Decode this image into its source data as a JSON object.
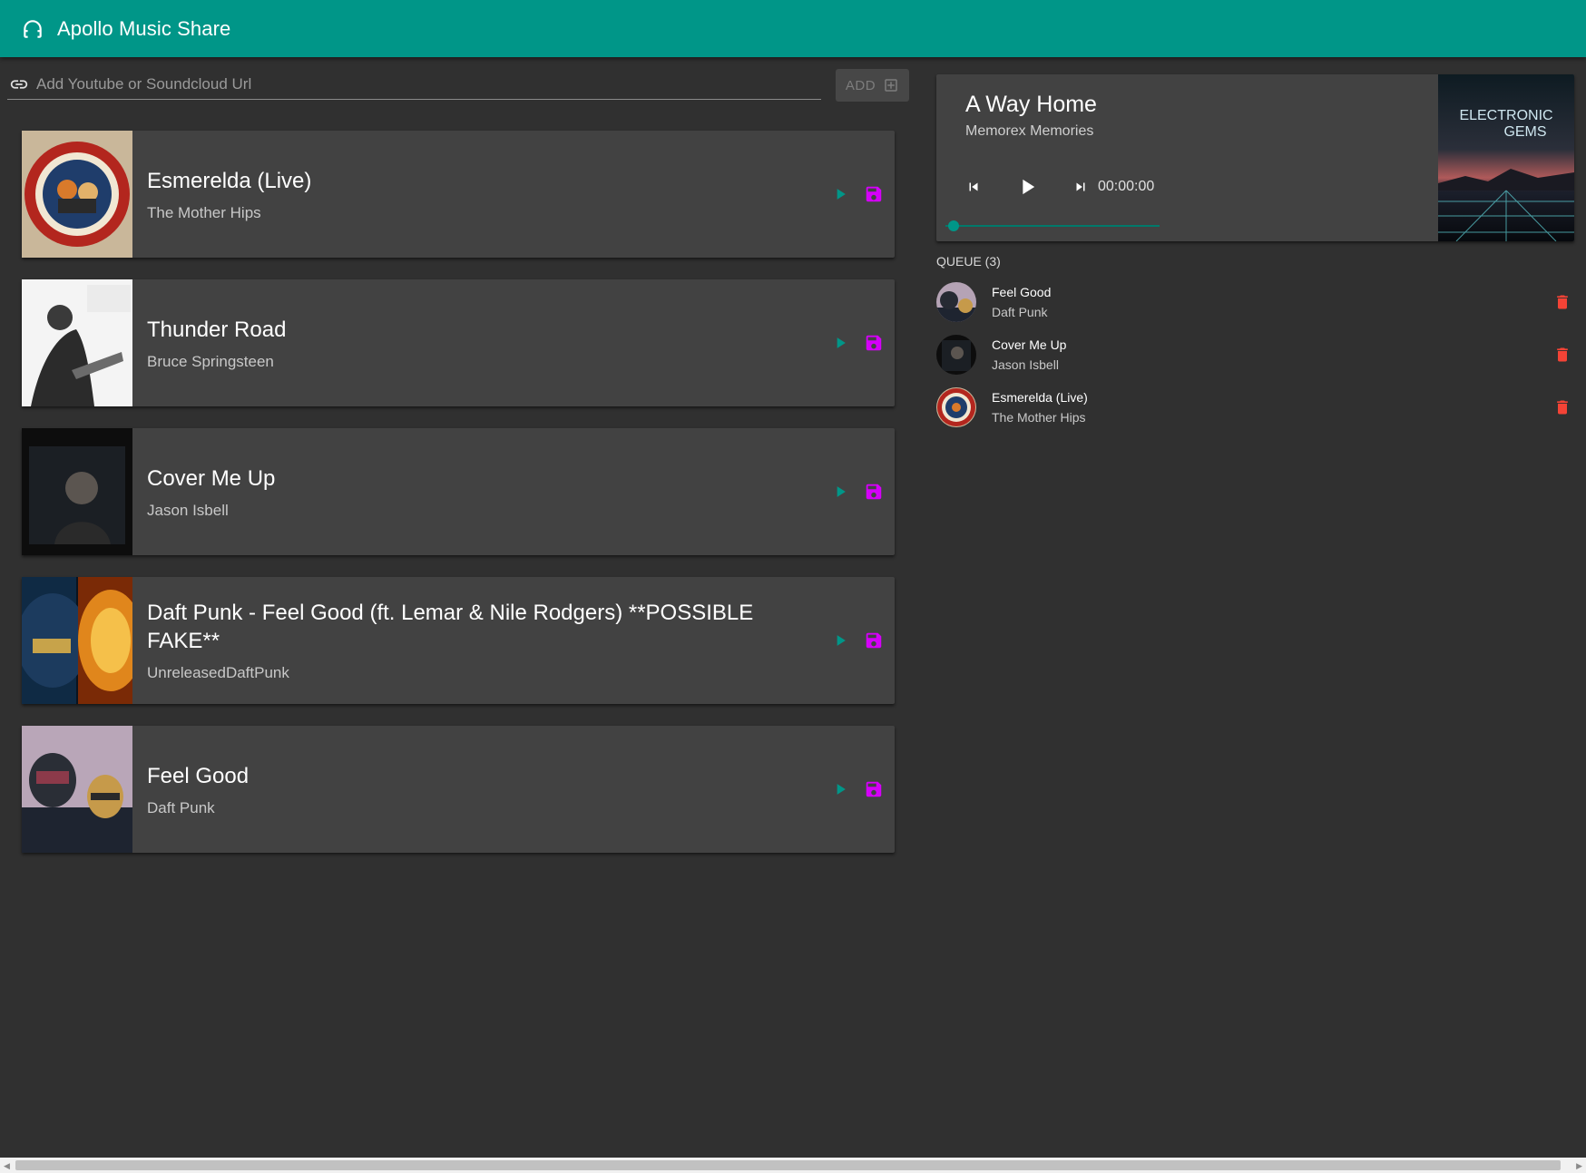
{
  "app": {
    "title": "Apollo Music Share",
    "icon": "headphones-icon",
    "accent_color": "#009688",
    "save_color": "#d500f9",
    "delete_color": "#f44336"
  },
  "url_input": {
    "placeholder": "Add Youtube or Soundcloud Url",
    "value": "",
    "add_label": "ADD"
  },
  "songs": [
    {
      "title": "Esmerelda (Live)",
      "artist": "The Mother Hips"
    },
    {
      "title": "Thunder Road",
      "artist": "Bruce Springsteen"
    },
    {
      "title": "Cover Me Up",
      "artist": "Jason Isbell"
    },
    {
      "title": "Daft Punk - Feel Good (ft. Lemar & Nile Rodgers) **POSSIBLE FAKE**",
      "artist": "UnreleasedDaftPunk"
    },
    {
      "title": "Feel Good",
      "artist": "Daft Punk"
    }
  ],
  "player": {
    "title": "A Way Home",
    "artist": "Memorex Memories",
    "time": "00:00:00",
    "progress": 0,
    "cover_text": [
      "ELECTRONIC",
      "GEMS"
    ]
  },
  "queue": {
    "heading": "QUEUE (3)",
    "items": [
      {
        "title": "Feel Good",
        "artist": "Daft Punk"
      },
      {
        "title": "Cover Me Up",
        "artist": "Jason Isbell"
      },
      {
        "title": "Esmerelda (Live)",
        "artist": "The Mother Hips"
      }
    ]
  }
}
